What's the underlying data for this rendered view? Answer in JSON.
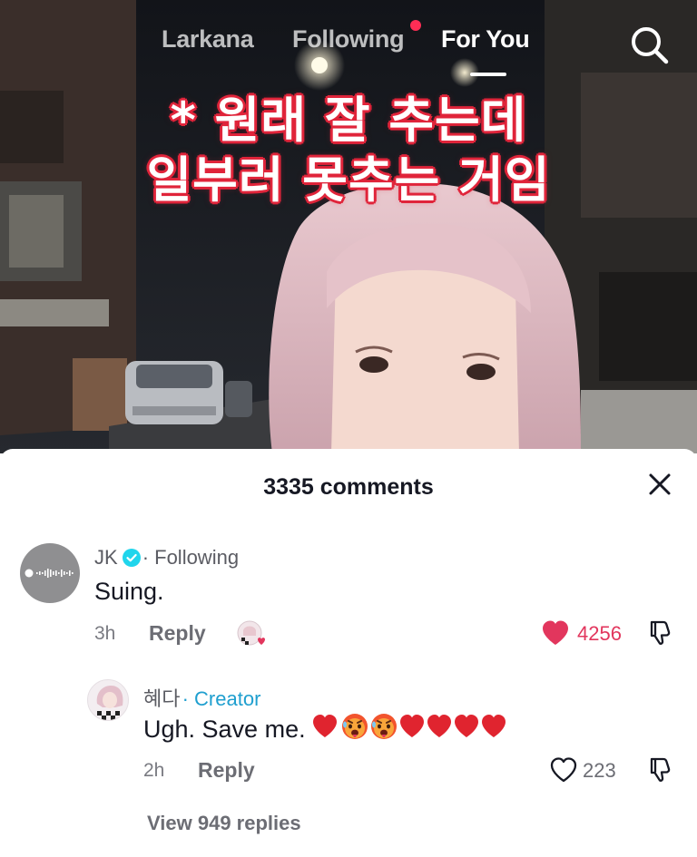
{
  "top_nav": {
    "tabs": [
      "Larkana",
      "Following",
      "For You"
    ],
    "active_tab": "For You",
    "icons": {
      "search": "search-icon",
      "live_dot": "notification-dot"
    }
  },
  "video": {
    "caption_lines": [
      "* 원래 잘 추는데",
      "일부러 못추는 거임"
    ]
  },
  "comments_sheet": {
    "title": "3335 comments",
    "close_icon": "close-icon"
  },
  "comments": [
    {
      "author": "JK",
      "verified": true,
      "tag": "· Following",
      "text": "Suing.",
      "time": "3h",
      "reply_label": "Reply",
      "likes": "4256",
      "liked": true
    },
    {
      "author": "혜다",
      "tag": "· Creator",
      "text": "Ugh. Save me.",
      "emojis": [
        "red-heart",
        "hot-face",
        "hot-face",
        "red-heart",
        "red-heart",
        "red-heart",
        "red-heart"
      ],
      "time": "2h",
      "reply_label": "Reply",
      "likes": "223",
      "liked": false
    }
  ],
  "view_replies": "View 949 replies",
  "colors": {
    "like_red": "#e2365d",
    "creator_blue": "#1f9fcf",
    "caption_red": "#e0243a"
  }
}
